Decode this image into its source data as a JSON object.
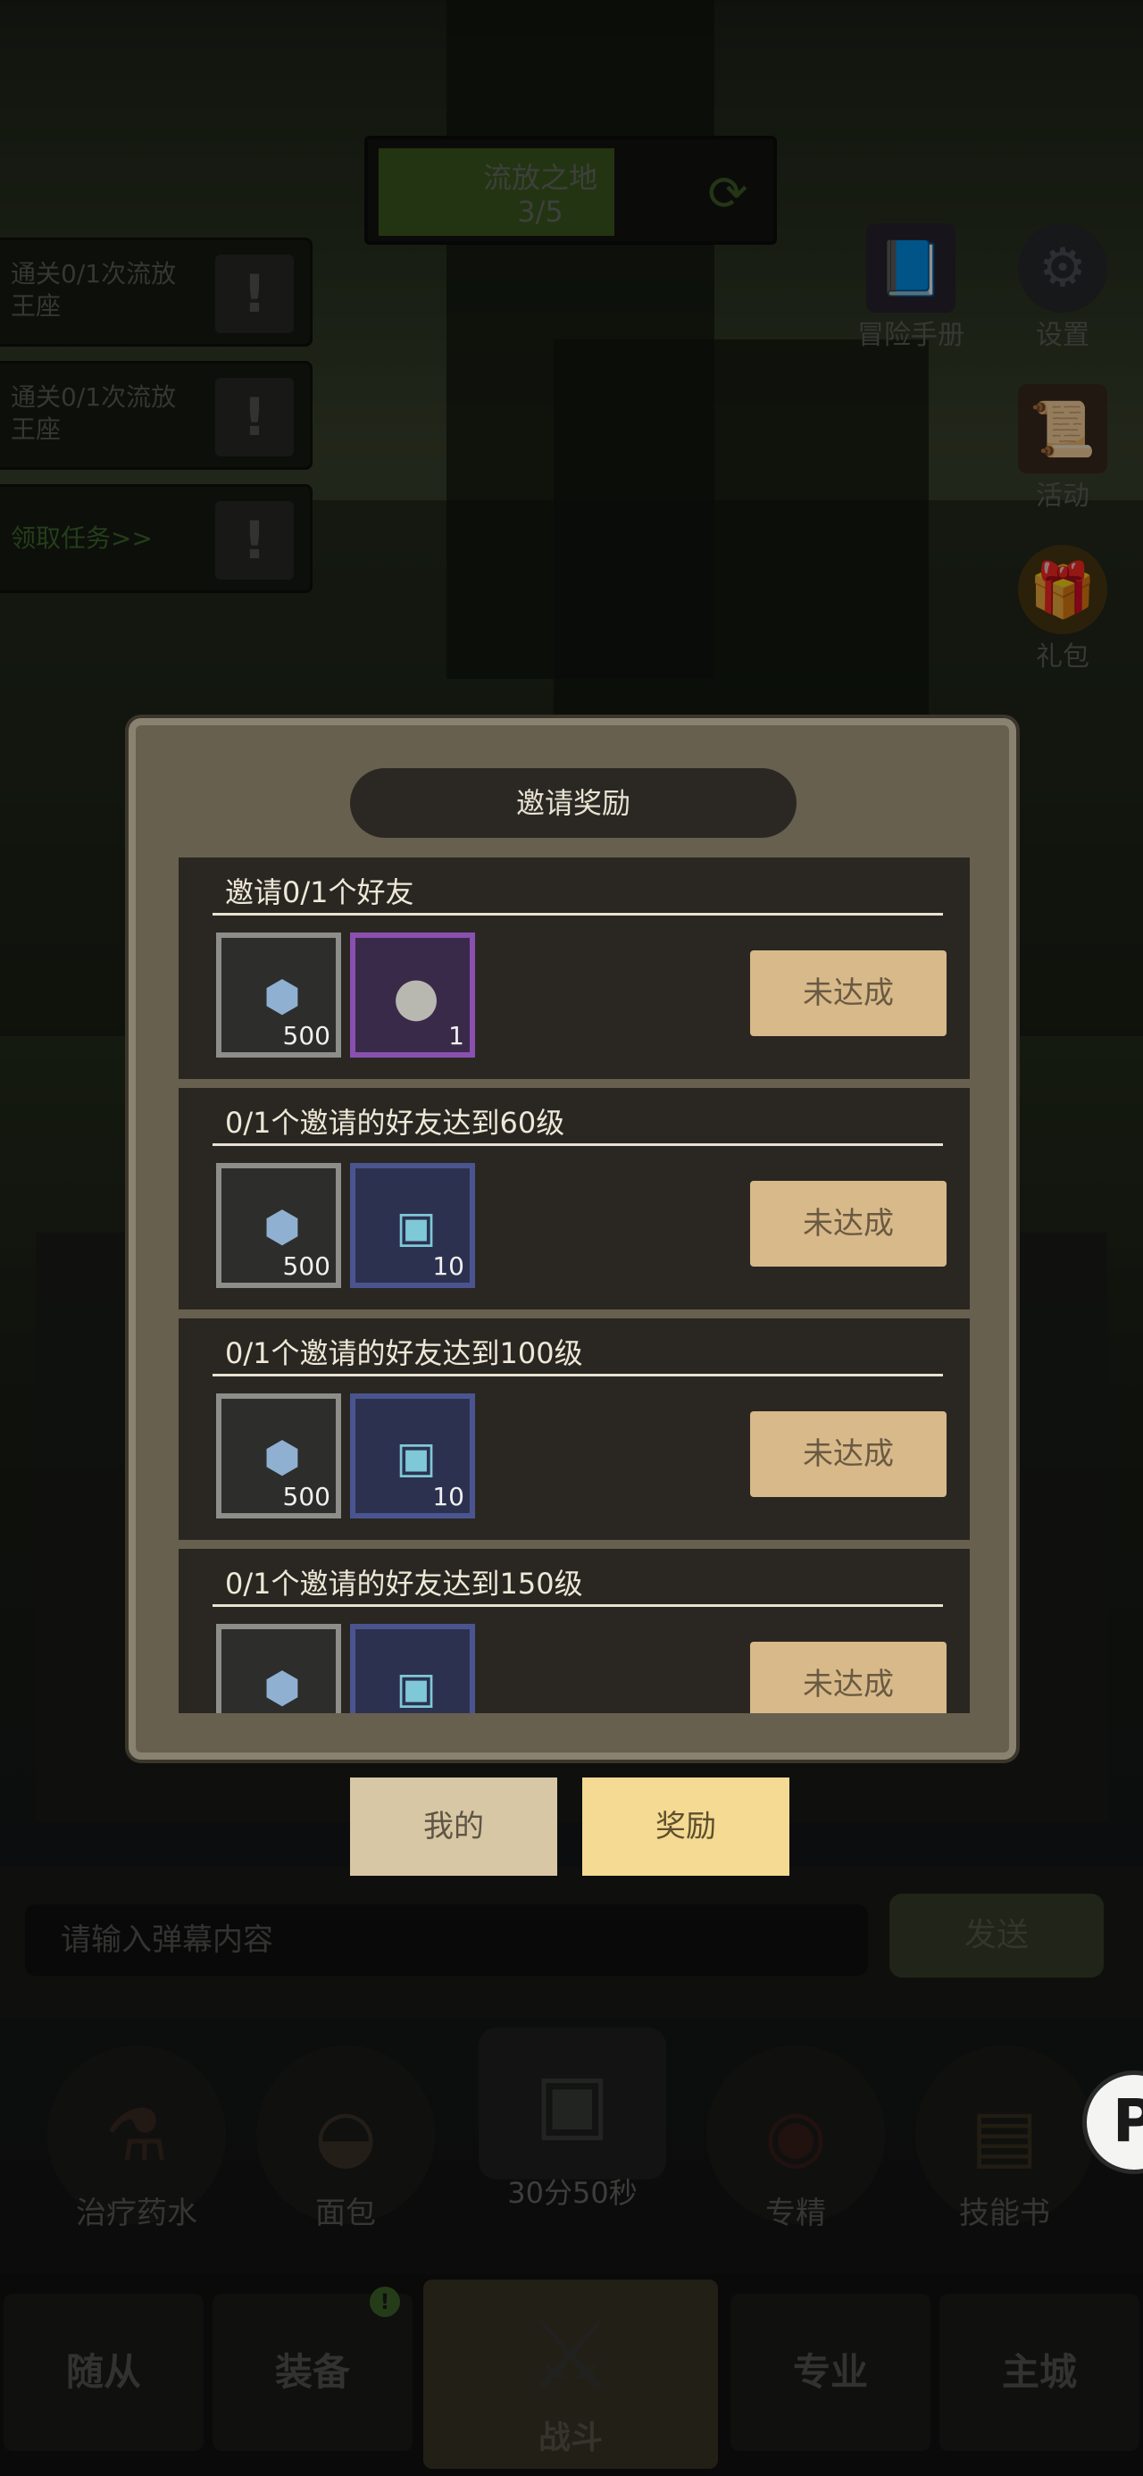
{
  "location": {
    "name": "流放之地",
    "progress": "3/5"
  },
  "tasks": [
    {
      "text": "通关0/1次流放王座"
    },
    {
      "text": "通关0/1次流放王座"
    },
    {
      "text": "领取任务>>"
    }
  ],
  "side_icons": [
    {
      "label": "冒险手册",
      "icon": "book-icon"
    },
    {
      "label": "设置",
      "icon": "gear-icon"
    },
    {
      "label": "活动",
      "icon": "scroll-icon"
    },
    {
      "label": "礼包",
      "icon": "gift-icon"
    }
  ],
  "modal": {
    "title": "邀请奖励",
    "rewards": [
      {
        "title": "邀请0/1个好友",
        "item1_count": "500",
        "item2_count": "1",
        "button": "未达成"
      },
      {
        "title": "0/1个邀请的好友达到60级",
        "item1_count": "500",
        "item2_count": "10",
        "button": "未达成"
      },
      {
        "title": "0/1个邀请的好友达到100级",
        "item1_count": "500",
        "item2_count": "10",
        "button": "未达成"
      },
      {
        "title": "0/1个邀请的好友达到150级",
        "item1_count": "",
        "item2_count": "",
        "button": "未达成"
      }
    ]
  },
  "tabs": {
    "mine": "我的",
    "reward": "奖励"
  },
  "chat": {
    "placeholder": "请输入弹幕内容",
    "send": "发送"
  },
  "consumables": {
    "potion": "治疗药水",
    "bread": "面包",
    "chest_timer": "30分50秒",
    "mastery": "专精",
    "skill_book": "技能书"
  },
  "nav": {
    "followers": "随从",
    "equipment": "装备",
    "battle": "战斗",
    "profession": "专业",
    "main_city": "主城",
    "badge": "!"
  }
}
